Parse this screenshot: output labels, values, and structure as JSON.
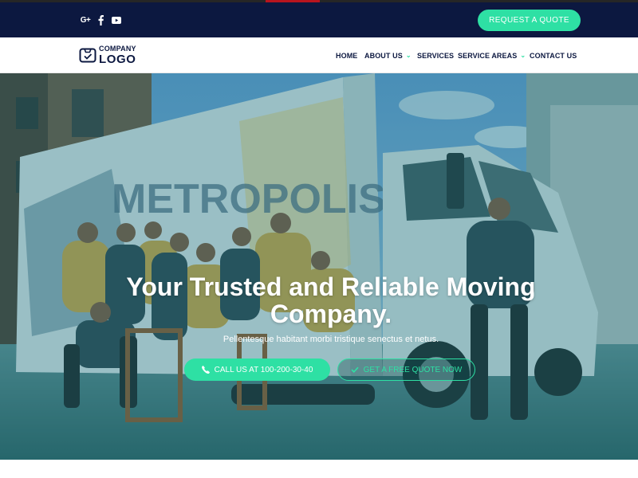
{
  "topbar": {
    "social": [
      {
        "name": "google-plus",
        "label": "G+"
      },
      {
        "name": "facebook",
        "label": "f"
      },
      {
        "name": "youtube",
        "label": ""
      }
    ],
    "quote_button": "REQUEST A QUOTE"
  },
  "logo": {
    "line1": "COMPANY",
    "line2": "LOGO"
  },
  "nav": {
    "items": [
      {
        "label": "HOME",
        "dropdown": false
      },
      {
        "label": "ABOUT US",
        "dropdown": true
      },
      {
        "label": "SERVICES",
        "dropdown": false
      },
      {
        "label": "SERVICE AREAS",
        "dropdown": true
      },
      {
        "label": "CONTACT US",
        "dropdown": false
      }
    ]
  },
  "hero": {
    "title": "Your Trusted and Reliable Moving Company.",
    "subtitle": "Pellentesque habitant morbi tristique senectus et netus.",
    "call_button": "CALL US AT 100-200-30-40",
    "free_quote_button": "GET A FREE QUOTE NOW",
    "truck_brand": "METROPOLIS"
  },
  "colors": {
    "navy": "#0c1840",
    "accent": "#2ee0a4",
    "red_marker": "#b8141e"
  }
}
